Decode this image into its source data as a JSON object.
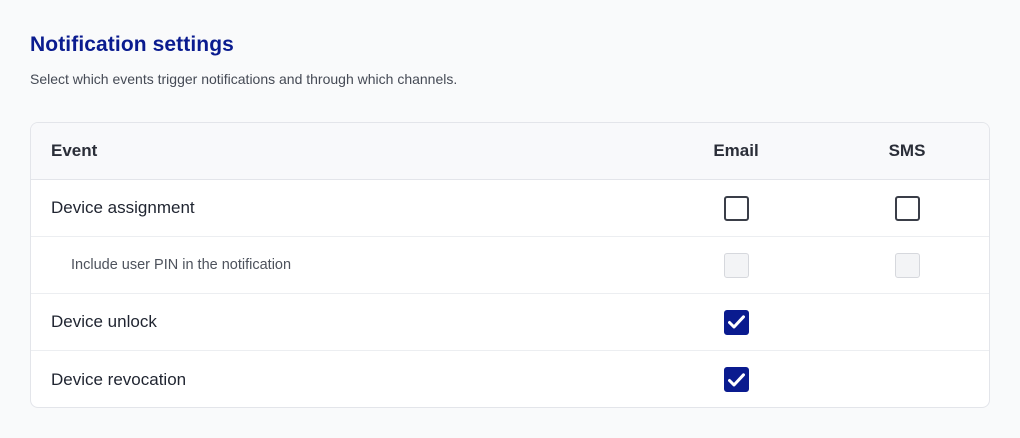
{
  "page": {
    "title": "Notification settings",
    "subtitle": "Select which events trigger notifications and through which channels."
  },
  "table": {
    "headers": {
      "event": "Event",
      "email": "Email",
      "sms": "SMS"
    },
    "rows": [
      {
        "label": "Device assignment",
        "email": false,
        "sms": false,
        "email_disabled": false,
        "sms_disabled": false
      },
      {
        "label": "Include user PIN in the notification",
        "email": false,
        "sms": false,
        "email_disabled": true,
        "sms_disabled": true
      },
      {
        "label": "Device unlock",
        "email": true,
        "email_disabled": false
      },
      {
        "label": "Device revocation",
        "email": true,
        "email_disabled": false
      }
    ]
  },
  "colors": {
    "accent": "#0a1b8f",
    "title": "#0a1b8f"
  },
  "icons": {
    "checkmark": "checkmark-icon"
  }
}
